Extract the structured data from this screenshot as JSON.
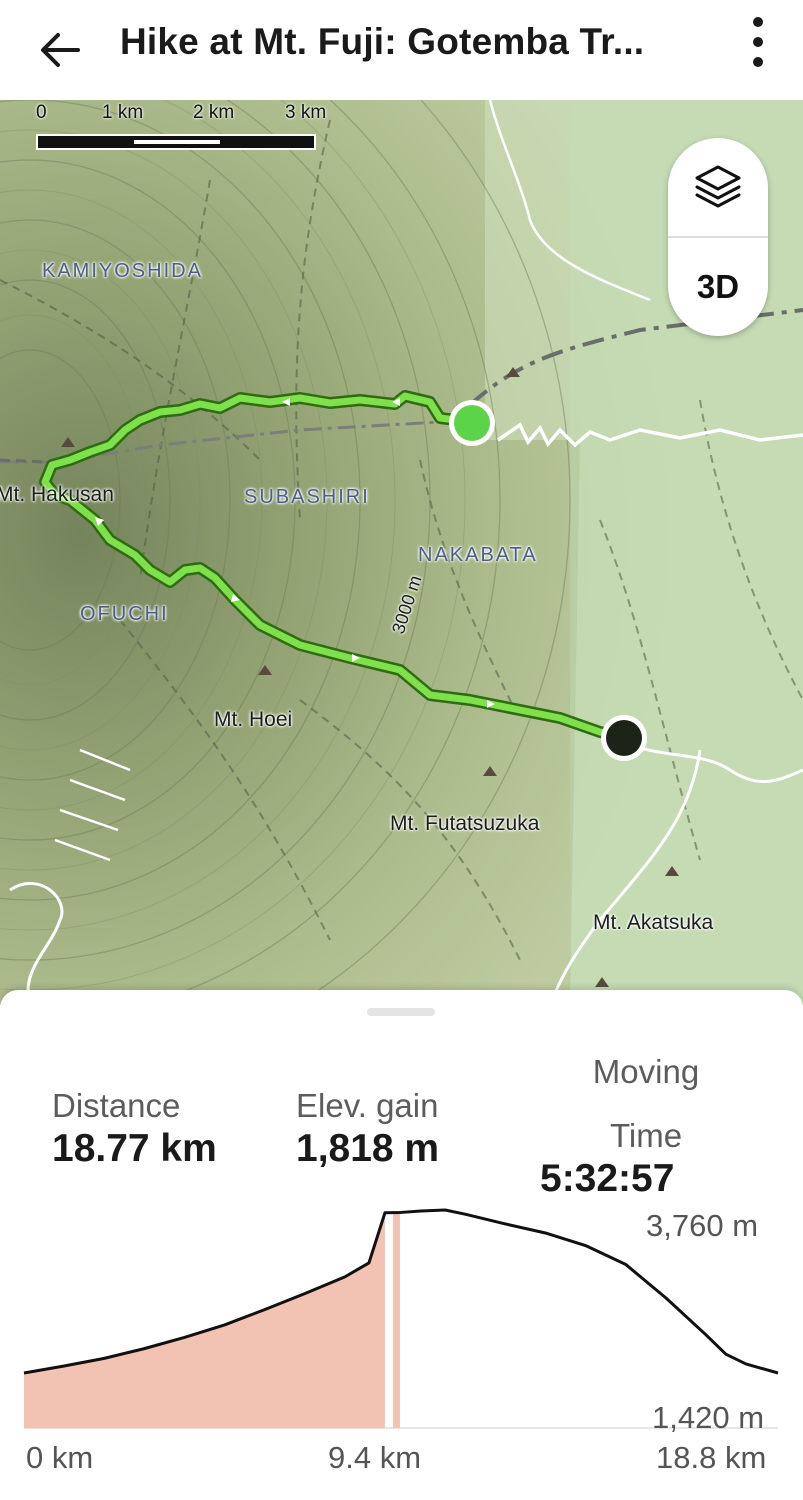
{
  "header": {
    "title": "Hike at Mt. Fuji: Gotemba Tr...",
    "back_icon": "arrow-left-icon",
    "more_icon": "more-vertical-icon"
  },
  "map": {
    "scale_labels": [
      "0",
      "1 km",
      "2 km",
      "3 km"
    ],
    "regions": [
      "KAMIYOSHIDA",
      "SUBASHIRI",
      "NAKABATA",
      "OFUCHI"
    ],
    "peaks": [
      "Mt. Hakusan",
      "Mt. Hoei",
      "Mt. Futatsuzuka",
      "Mt. Akatsuka"
    ],
    "contour_label": "3000 m",
    "layers_icon": "layers-icon",
    "threed_label": "3D",
    "colors": {
      "route": "#7ee04a",
      "route_outline": "#2f6b12",
      "start_marker": "#5bd44a",
      "end_marker": "#1c2418"
    }
  },
  "stats": {
    "distance_label": "Distance",
    "distance_value": "18.77 km",
    "elev_gain_label": "Elev. gain",
    "elev_gain_value": "1,818 m",
    "moving_label_line1": "Moving",
    "moving_label_line2": "Time",
    "moving_value": "5:32:57"
  },
  "chart_data": {
    "type": "area",
    "x": [
      0,
      1,
      2,
      3,
      4,
      5,
      6,
      7,
      8,
      8.6,
      9.0,
      9.4,
      9.9,
      10.5,
      11,
      12,
      13,
      14,
      15,
      16,
      17,
      17.5,
      18,
      18.8
    ],
    "y": [
      1420,
      1520,
      1630,
      1770,
      1930,
      2110,
      2330,
      2560,
      2800,
      3000,
      3720,
      3725,
      3745,
      3760,
      3700,
      3560,
      3430,
      3250,
      2980,
      2500,
      1970,
      1690,
      1550,
      1420
    ],
    "x_unit": "km",
    "y_unit": "m",
    "xlim": [
      0,
      18.8
    ],
    "ylim": [
      1420,
      3760
    ],
    "x_tick_labels": [
      "0 km",
      "9.4 km",
      "18.8 km"
    ],
    "y_tick_labels": [
      "3,760 m",
      "1,420 m"
    ],
    "highlight_until_km": 9.0,
    "colors": {
      "fill": "#f2c3b3",
      "line": "#111111"
    }
  }
}
